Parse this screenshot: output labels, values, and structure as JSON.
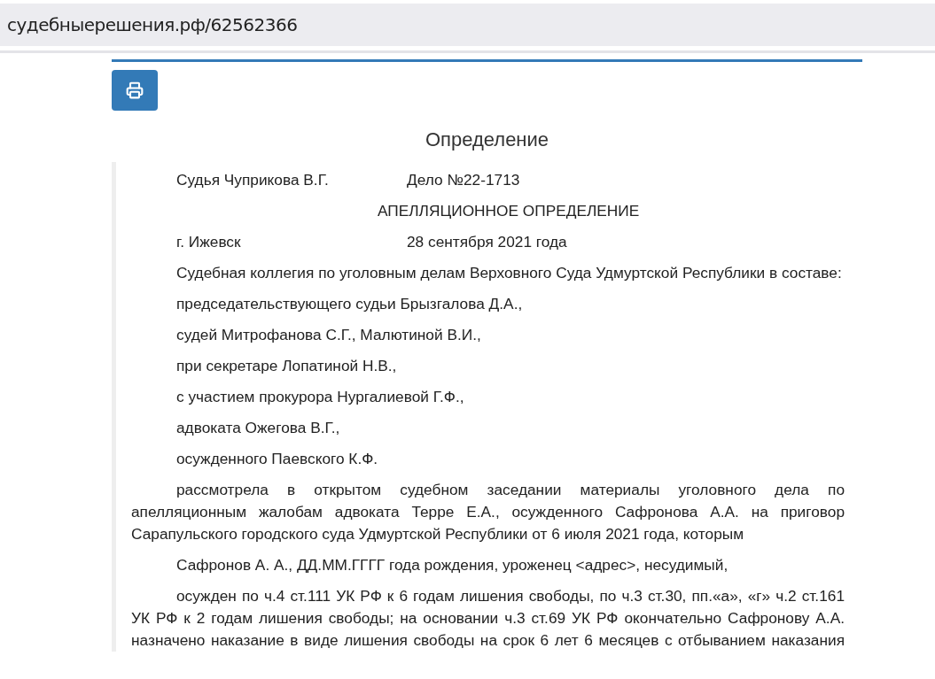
{
  "address_bar": {
    "url": "судебныерешения.рф/62562366"
  },
  "heading": "Определение",
  "document": [
    {
      "kind": "pair",
      "left": "Судья Чуприкова В.Г.",
      "right": "Дело №22-1713"
    },
    {
      "kind": "center",
      "text": "АПЕЛЛЯЦИОННОЕ ОПРЕДЕЛЕНИЕ"
    },
    {
      "kind": "pair",
      "left": "г. Ижевск",
      "right": "28 сентября 2021 года"
    },
    {
      "kind": "para",
      "text": "Судебная коллегия по уголовным делам Верховного Суда Удмуртской Республики в составе:"
    },
    {
      "kind": "para",
      "text": "председательствующего судьи Брызгалова Д.А.,"
    },
    {
      "kind": "para",
      "text": "судей Митрофанова С.Г., Малютиной В.И.,"
    },
    {
      "kind": "para",
      "text": "при секретаре Лопатиной Н.В.,"
    },
    {
      "kind": "para",
      "text": "с участием прокурора Нургалиевой Г.Ф.,"
    },
    {
      "kind": "para",
      "text": "адвоката Ожегова В.Г.,"
    },
    {
      "kind": "para",
      "text": "осужденного Паевского К.Ф."
    },
    {
      "kind": "para",
      "text": "рассмотрела в открытом судебном заседании материалы уголовного дела по апелляционным жалобам адвоката Терре Е.А., осужденного Сафронова А.А. на приговор Сарапульского городского суда Удмуртской Республики от 6 июля 2021 года, которым"
    },
    {
      "kind": "para",
      "text": "Сафронов А. А., ДД.ММ.ГГГГ года рождения, уроженец <адрес>, несудимый,"
    },
    {
      "kind": "para",
      "cut_off": true,
      "text": "осужден по ч.4 ст.111 УК РФ к 6 годам лишения свободы, по ч.3 ст.30, пп.«а», «г» ч.2 ст.161 УК РФ к 2 годам лишения свободы; на основании ч.3 ст.69 УК РФ окончательно Сафронову А.А. назначено наказание в виде лишения свободы на срок 6 лет 6 месяцев с отбыванием наказания"
    }
  ]
}
